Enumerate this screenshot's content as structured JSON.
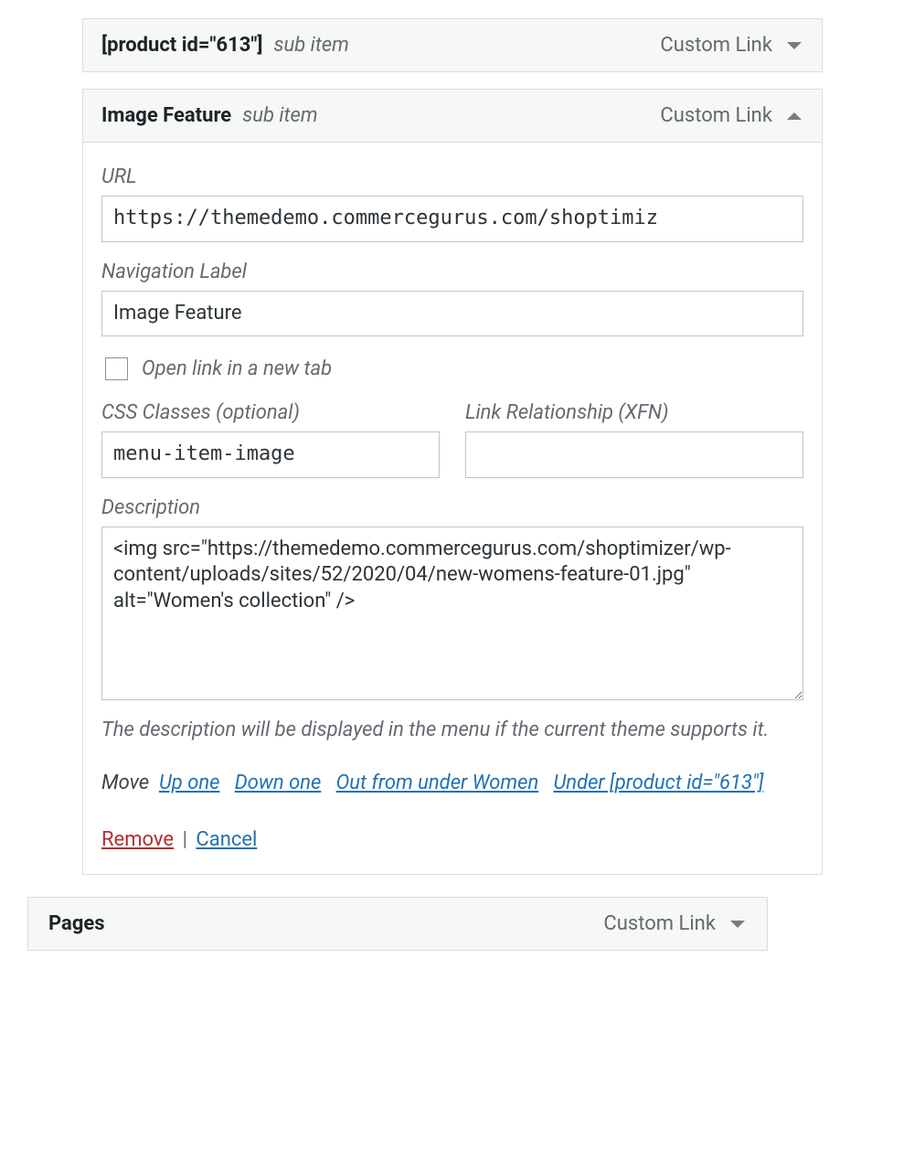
{
  "item1": {
    "title": "[product id=\"613\"]",
    "sub": "sub item",
    "type": "Custom Link"
  },
  "item2": {
    "title": "Image Feature",
    "sub": "sub item",
    "type": "Custom Link",
    "labels": {
      "url": "URL",
      "navLabel": "Navigation Label",
      "newTab": "Open link in a new tab",
      "cssClasses": "CSS Classes (optional)",
      "xfn": "Link Relationship (XFN)",
      "description": "Description",
      "descNote": "The description will be displayed in the menu if the current theme supports it.",
      "move": "Move",
      "upOne": "Up one",
      "downOne": "Down one",
      "outFrom": "Out from under Women",
      "under": "Under [product id=\"613\"]",
      "remove": "Remove",
      "cancel": "Cancel"
    },
    "values": {
      "url": "https://themedemo.commercegurus.com/shoptimiz",
      "navLabel": "Image Feature",
      "cssClasses": "menu-item-image",
      "xfn": "",
      "description": "<img src=\"https://themedemo.commercegurus.com/shoptimizer/wp-content/uploads/sites/52/2020/04/new-womens-feature-01.jpg\" alt=\"Women's collection\" />"
    }
  },
  "item3": {
    "title": "Pages",
    "type": "Custom Link"
  }
}
